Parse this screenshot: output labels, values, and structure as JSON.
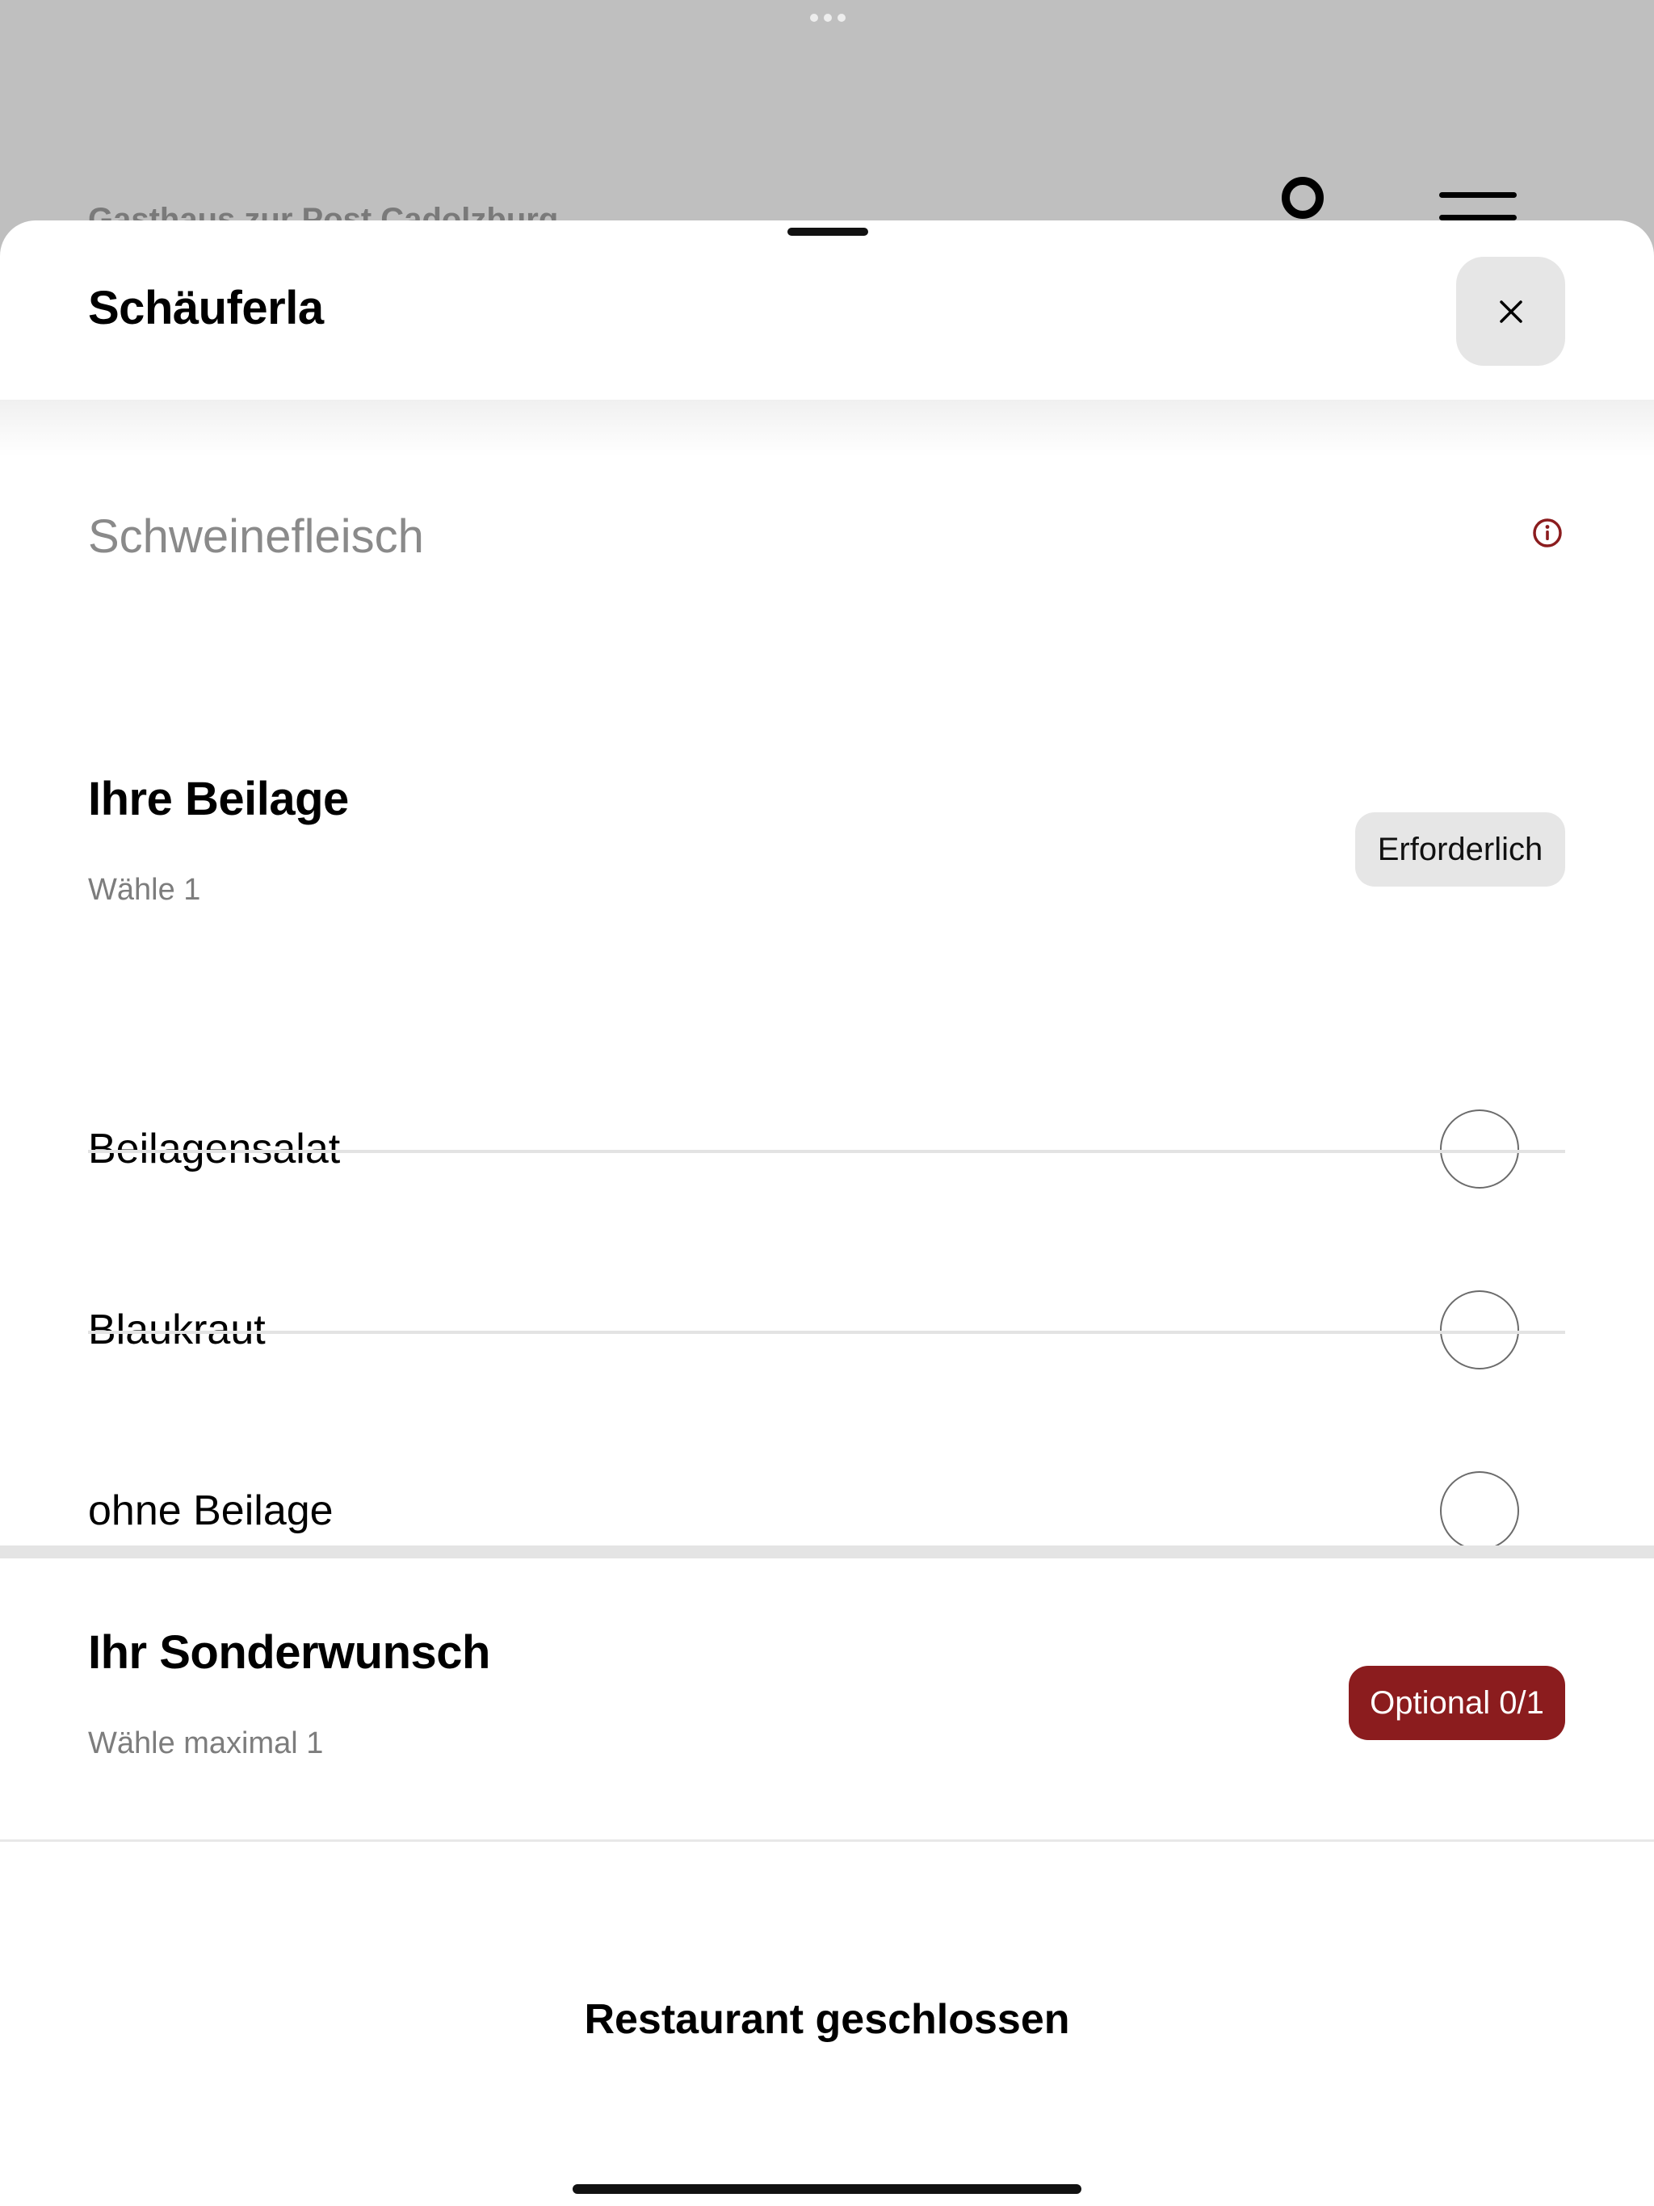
{
  "background": {
    "restaurant_title": "Gasthaus zur Post Cadolzburg",
    "icons": [
      "account-icon",
      "menu-icon",
      "multitask-dots-icon"
    ]
  },
  "sheet": {
    "title": "Schäuferla",
    "close_symbol": "×",
    "description": "Schweinefleisch"
  },
  "sections": [
    {
      "title": "Ihre Beilage",
      "subtitle": "Wähle 1",
      "badge": "Erforderlich",
      "options": [
        {
          "label": "Beilagensalat",
          "selected": false
        },
        {
          "label": "Blaukraut",
          "selected": false
        },
        {
          "label": "ohne Beilage",
          "selected": false
        }
      ]
    },
    {
      "title": "Ihr Sonderwunsch",
      "subtitle": "Wähle maximal 1",
      "badge": "Optional 0/1"
    }
  ],
  "footer": {
    "status": "Restaurant geschlossen"
  },
  "colors": {
    "accent": "#8b1c1e",
    "badge_neutral": "#e6e6e6",
    "overlay": "#bfbfbf"
  }
}
